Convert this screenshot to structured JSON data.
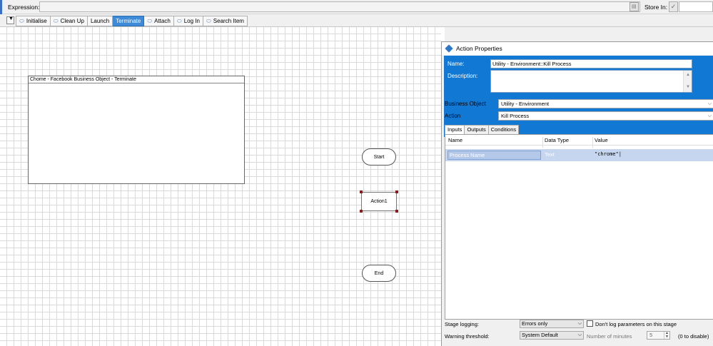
{
  "expression_bar": {
    "expression_label": "Expression:",
    "expression_value": "",
    "store_label": "Store In:",
    "store_value": ""
  },
  "page_tabs": [
    {
      "label": "Initialise",
      "icon": "page-icon",
      "active": false
    },
    {
      "label": "Clean Up",
      "icon": "page-icon",
      "active": false
    },
    {
      "label": "Launch",
      "icon": "",
      "active": false
    },
    {
      "label": "Terminate",
      "icon": "",
      "active": true
    },
    {
      "label": "Attach",
      "icon": "page-icon",
      "active": false
    },
    {
      "label": "Log In",
      "icon": "page-icon",
      "active": false
    },
    {
      "label": "Search Item",
      "icon": "page-icon",
      "active": false
    }
  ],
  "canvas": {
    "block_title": "Chome - Facebook Business Object - Terminate",
    "start_label": "Start",
    "action_label": "Action1",
    "end_label": "End"
  },
  "dialog": {
    "title": "Action Properties",
    "name_label": "Name:",
    "name_value": "Utility - Environment::Kill Process",
    "description_label": "Description:",
    "description_value": "",
    "business_object_label": "Business Object",
    "business_object_value": "Utility - Environment",
    "action_label": "Action",
    "action_value": "Kill Process",
    "tabs": [
      "Inputs",
      "Outputs",
      "Conditions"
    ],
    "active_tab": "Inputs",
    "grid_headers": {
      "name": "Name",
      "data_type": "Data Type",
      "value": "Value"
    },
    "grid_rows": [
      {
        "name": "Process Name",
        "data_type": "Text",
        "value": "\"chrome\""
      }
    ],
    "stage_logging_label": "Stage logging:",
    "stage_logging_value": "Errors only",
    "dont_log_label": "Don't log parameters on this stage",
    "warning_label": "Warning threshold:",
    "warning_value": "System Default",
    "minutes_label": "Number of minutes",
    "minutes_value": "5",
    "minutes_hint": "(0 to disable)"
  },
  "colors": {
    "active_tab": "#3c8ad8",
    "dialog_header": "#1179d4",
    "selection": "#c6d6ee",
    "handle": "#8b1c1c"
  }
}
